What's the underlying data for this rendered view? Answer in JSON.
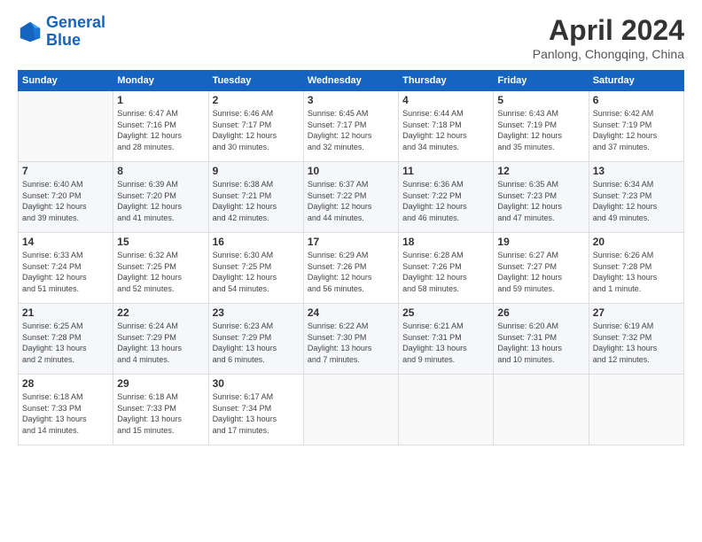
{
  "logo": {
    "line1": "General",
    "line2": "Blue"
  },
  "title": "April 2024",
  "subtitle": "Panlong, Chongqing, China",
  "days_header": [
    "Sunday",
    "Monday",
    "Tuesday",
    "Wednesday",
    "Thursday",
    "Friday",
    "Saturday"
  ],
  "weeks": [
    [
      {
        "num": "",
        "info": ""
      },
      {
        "num": "1",
        "info": "Sunrise: 6:47 AM\nSunset: 7:16 PM\nDaylight: 12 hours\nand 28 minutes."
      },
      {
        "num": "2",
        "info": "Sunrise: 6:46 AM\nSunset: 7:17 PM\nDaylight: 12 hours\nand 30 minutes."
      },
      {
        "num": "3",
        "info": "Sunrise: 6:45 AM\nSunset: 7:17 PM\nDaylight: 12 hours\nand 32 minutes."
      },
      {
        "num": "4",
        "info": "Sunrise: 6:44 AM\nSunset: 7:18 PM\nDaylight: 12 hours\nand 34 minutes."
      },
      {
        "num": "5",
        "info": "Sunrise: 6:43 AM\nSunset: 7:19 PM\nDaylight: 12 hours\nand 35 minutes."
      },
      {
        "num": "6",
        "info": "Sunrise: 6:42 AM\nSunset: 7:19 PM\nDaylight: 12 hours\nand 37 minutes."
      }
    ],
    [
      {
        "num": "7",
        "info": "Sunrise: 6:40 AM\nSunset: 7:20 PM\nDaylight: 12 hours\nand 39 minutes."
      },
      {
        "num": "8",
        "info": "Sunrise: 6:39 AM\nSunset: 7:20 PM\nDaylight: 12 hours\nand 41 minutes."
      },
      {
        "num": "9",
        "info": "Sunrise: 6:38 AM\nSunset: 7:21 PM\nDaylight: 12 hours\nand 42 minutes."
      },
      {
        "num": "10",
        "info": "Sunrise: 6:37 AM\nSunset: 7:22 PM\nDaylight: 12 hours\nand 44 minutes."
      },
      {
        "num": "11",
        "info": "Sunrise: 6:36 AM\nSunset: 7:22 PM\nDaylight: 12 hours\nand 46 minutes."
      },
      {
        "num": "12",
        "info": "Sunrise: 6:35 AM\nSunset: 7:23 PM\nDaylight: 12 hours\nand 47 minutes."
      },
      {
        "num": "13",
        "info": "Sunrise: 6:34 AM\nSunset: 7:23 PM\nDaylight: 12 hours\nand 49 minutes."
      }
    ],
    [
      {
        "num": "14",
        "info": "Sunrise: 6:33 AM\nSunset: 7:24 PM\nDaylight: 12 hours\nand 51 minutes."
      },
      {
        "num": "15",
        "info": "Sunrise: 6:32 AM\nSunset: 7:25 PM\nDaylight: 12 hours\nand 52 minutes."
      },
      {
        "num": "16",
        "info": "Sunrise: 6:30 AM\nSunset: 7:25 PM\nDaylight: 12 hours\nand 54 minutes."
      },
      {
        "num": "17",
        "info": "Sunrise: 6:29 AM\nSunset: 7:26 PM\nDaylight: 12 hours\nand 56 minutes."
      },
      {
        "num": "18",
        "info": "Sunrise: 6:28 AM\nSunset: 7:26 PM\nDaylight: 12 hours\nand 58 minutes."
      },
      {
        "num": "19",
        "info": "Sunrise: 6:27 AM\nSunset: 7:27 PM\nDaylight: 12 hours\nand 59 minutes."
      },
      {
        "num": "20",
        "info": "Sunrise: 6:26 AM\nSunset: 7:28 PM\nDaylight: 13 hours\nand 1 minute."
      }
    ],
    [
      {
        "num": "21",
        "info": "Sunrise: 6:25 AM\nSunset: 7:28 PM\nDaylight: 13 hours\nand 2 minutes."
      },
      {
        "num": "22",
        "info": "Sunrise: 6:24 AM\nSunset: 7:29 PM\nDaylight: 13 hours\nand 4 minutes."
      },
      {
        "num": "23",
        "info": "Sunrise: 6:23 AM\nSunset: 7:29 PM\nDaylight: 13 hours\nand 6 minutes."
      },
      {
        "num": "24",
        "info": "Sunrise: 6:22 AM\nSunset: 7:30 PM\nDaylight: 13 hours\nand 7 minutes."
      },
      {
        "num": "25",
        "info": "Sunrise: 6:21 AM\nSunset: 7:31 PM\nDaylight: 13 hours\nand 9 minutes."
      },
      {
        "num": "26",
        "info": "Sunrise: 6:20 AM\nSunset: 7:31 PM\nDaylight: 13 hours\nand 10 minutes."
      },
      {
        "num": "27",
        "info": "Sunrise: 6:19 AM\nSunset: 7:32 PM\nDaylight: 13 hours\nand 12 minutes."
      }
    ],
    [
      {
        "num": "28",
        "info": "Sunrise: 6:18 AM\nSunset: 7:33 PM\nDaylight: 13 hours\nand 14 minutes."
      },
      {
        "num": "29",
        "info": "Sunrise: 6:18 AM\nSunset: 7:33 PM\nDaylight: 13 hours\nand 15 minutes."
      },
      {
        "num": "30",
        "info": "Sunrise: 6:17 AM\nSunset: 7:34 PM\nDaylight: 13 hours\nand 17 minutes."
      },
      {
        "num": "",
        "info": ""
      },
      {
        "num": "",
        "info": ""
      },
      {
        "num": "",
        "info": ""
      },
      {
        "num": "",
        "info": ""
      }
    ]
  ]
}
